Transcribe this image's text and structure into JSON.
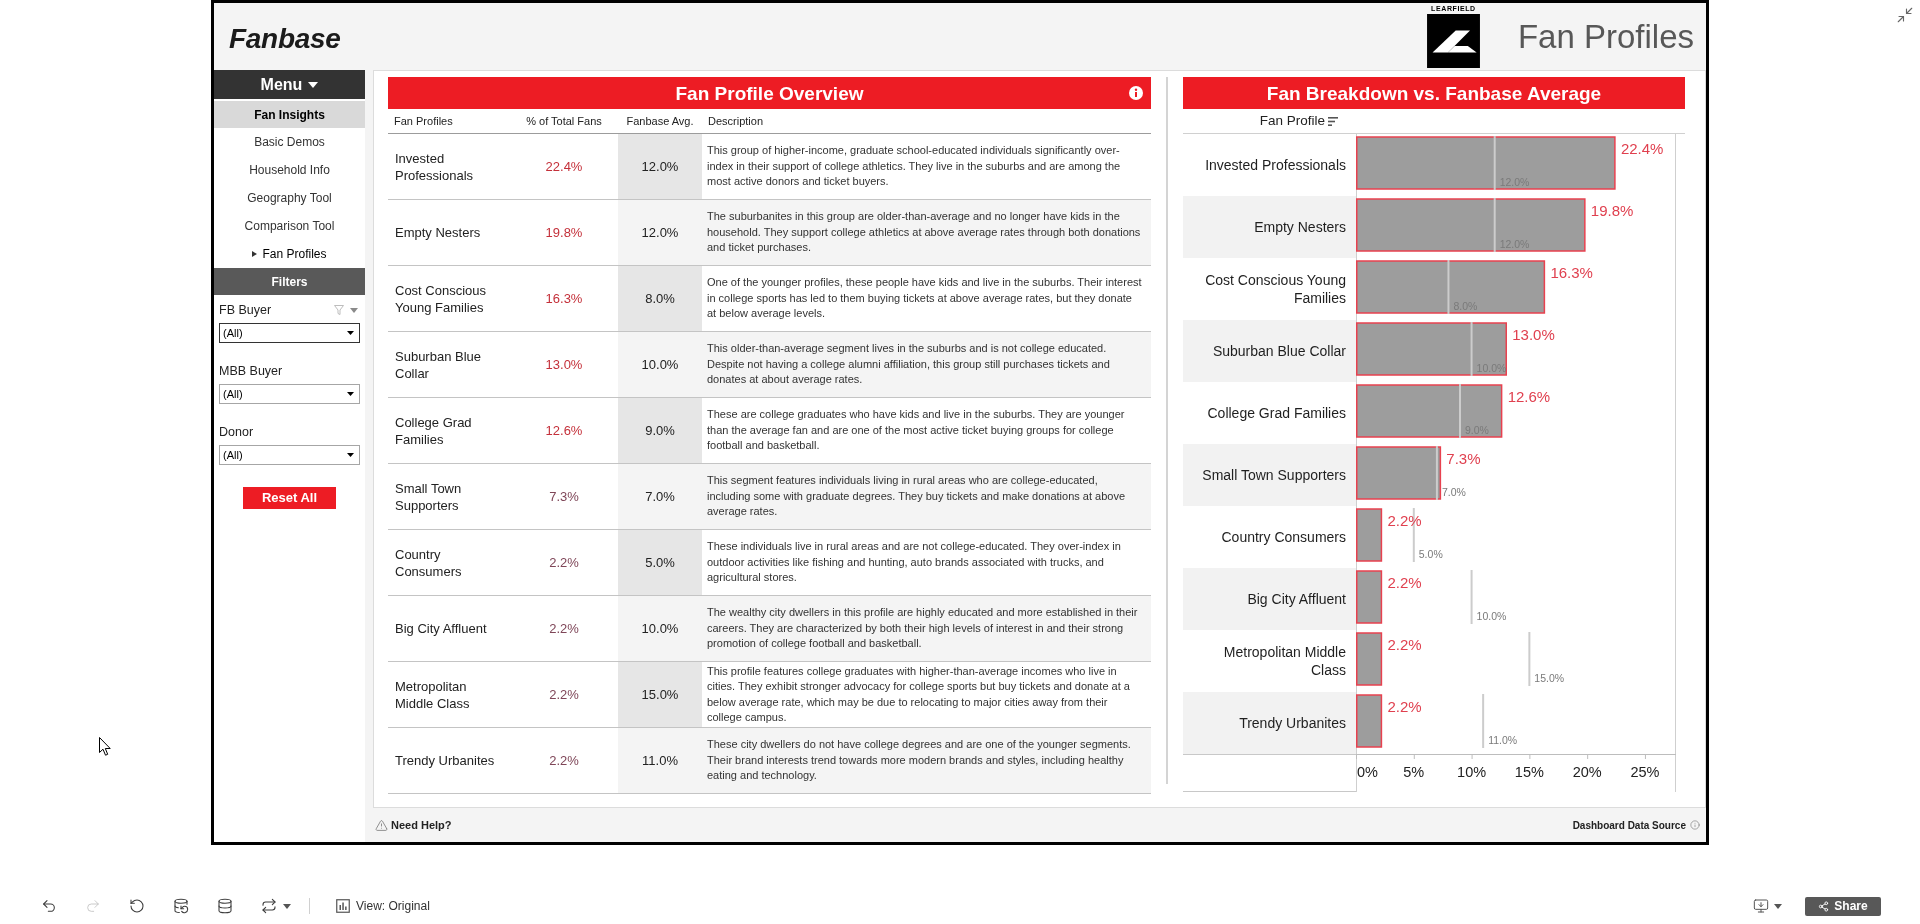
{
  "header": {
    "logo": "Fanbase",
    "partner_logo": "LEARFIELD",
    "title": "Fan Profiles"
  },
  "menu": {
    "title": "Menu",
    "section": "Fan Insights",
    "items": [
      {
        "label": "Basic Demos",
        "selected": false
      },
      {
        "label": "Household Info",
        "selected": false
      },
      {
        "label": "Geography Tool",
        "selected": false
      },
      {
        "label": "Comparison Tool",
        "selected": false
      },
      {
        "label": "Fan Profiles",
        "selected": true
      }
    ]
  },
  "filters": {
    "title": "Filters",
    "items": [
      {
        "label": "FB Buyer",
        "value": "(All)",
        "hovered": true
      },
      {
        "label": "MBB Buyer",
        "value": "(All)",
        "hovered": false
      },
      {
        "label": "Donor",
        "value": "(All)",
        "hovered": false
      }
    ],
    "reset_button": "Reset All"
  },
  "overview": {
    "title": "Fan Profile Overview",
    "columns": [
      "Fan Profiles",
      "% of Total Fans",
      "Fanbase Avg.",
      "Description"
    ],
    "rows": [
      {
        "profile": "Invested Professionals",
        "share": "22.4%",
        "color": "#c4303a",
        "average": "12.0%",
        "description": "This group of higher-income, graduate school-educated individuals significantly over-index in their support of college athletics. They live in the suburbs and are among the most active donors and ticket buyers."
      },
      {
        "profile": "Empty Nesters",
        "share": "19.8%",
        "color": "#c4303a",
        "average": "12.0%",
        "description": "The suburbanites in this group are older-than-average and no longer have kids in the household. They support college athletics at above average rates through both donations and ticket purchases."
      },
      {
        "profile": "Cost Conscious Young Families",
        "share": "16.3%",
        "color": "#c4303a",
        "average": "8.0%",
        "description": "One of the younger profiles, these people have kids and live in the suburbs. Their interest in college sports has led to them buying tickets at above average rates, but they donate at below average levels."
      },
      {
        "profile": "Suburban Blue Collar",
        "share": "13.0%",
        "color": "#c4303a",
        "average": "10.0%",
        "description": "This older-than-average segment lives in the suburbs and is not college educated. Despite not having a college alumni affiliation, this group still purchases tickets and donates at about average rates."
      },
      {
        "profile": "College Grad Families",
        "share": "12.6%",
        "color": "#c4303a",
        "average": "9.0%",
        "description": "These are college graduates who have kids and live in the suburbs. They are younger than the average fan and are one of the most active ticket buying groups for college football and basketball."
      },
      {
        "profile": "Small Town Supporters",
        "share": "7.3%",
        "color": "#7f4658",
        "average": "7.0%",
        "description": "This segment features individuals living in rural areas who are college-educated, including some with graduate degrees. They buy tickets and make donations at above average rates."
      },
      {
        "profile": "Country Consumers",
        "share": "2.2%",
        "color": "#7f4658",
        "average": "5.0%",
        "description": "These individuals live in rural areas and are not college-educated. They over-index in outdoor activities like fishing and hunting, auto brands associated with trucks, and agricultural stores."
      },
      {
        "profile": "Big City Affluent",
        "share": "2.2%",
        "color": "#7f4658",
        "average": "10.0%",
        "description": "The wealthy city dwellers in this profile are highly educated and more established in their careers. They are characterized by both their high levels of interest in and their strong promotion of college football and basketball."
      },
      {
        "profile": "Metropolitan Middle Class",
        "share": "2.2%",
        "color": "#7f4658",
        "average": "15.0%",
        "description": "This profile features college graduates with higher-than-average incomes who live in cities. They exhibit stronger advocacy for college sports but buy tickets and donate at a below average rate, which may be due to relocating to major cities away from their college campus."
      },
      {
        "profile": "Trendy Urbanites",
        "share": "2.2%",
        "color": "#7f4658",
        "average": "11.0%",
        "description": "These city dwellers do not have college degrees and are one of the younger segments. Their brand interests trend towards more modern brands and styles, including healthy eating and technology."
      }
    ]
  },
  "breakdown": {
    "chart_data": {
      "type": "bar",
      "orientation": "horizontal",
      "title": "Fan Breakdown vs. Fanbase Average",
      "ylabel": "Fan Profile",
      "categories": [
        "Invested Professionals",
        "Empty Nesters",
        "Cost Conscious Young Families",
        "Suburban Blue Collar",
        "College Grad Families",
        "Small Town Supporters",
        "Country Consumers",
        "Big City Affluent",
        "Metropolitan Middle Class",
        "Trendy Urbanites"
      ],
      "series": [
        {
          "color": "#9d9d9d",
          "values": [
            22.4,
            19.8,
            16.3,
            13.0,
            12.6,
            7.3,
            2.2,
            2.2,
            2.2,
            2.2
          ],
          "value_labels": [
            "22.4%",
            "19.8%",
            "16.3%",
            "13.0%",
            "12.6%",
            "7.3%",
            "2.2%",
            "2.2%",
            "2.2%",
            "2.2%"
          ]
        }
      ],
      "xlim": [
        0,
        27.6
      ],
      "xticks": [
        {
          "value": 0,
          "label": "0%"
        },
        {
          "value": 5,
          "label": "5%"
        },
        {
          "value": 10,
          "label": "10%"
        },
        {
          "value": 15,
          "label": "15%"
        },
        {
          "value": 20,
          "label": "20%"
        },
        {
          "value": 25,
          "label": "25%"
        }
      ],
      "annotations": [
        "12.0%",
        "12.0%",
        "8.0%",
        "10.0%",
        "9.0%",
        "7.0%",
        "5.0%",
        "10.0%",
        "15.0%",
        "11.0%"
      ]
    }
  },
  "footer": {
    "help": "Need Help?",
    "source": "Dashboard Data Source"
  },
  "toolbar": {
    "buttons": [
      {
        "kind": "undo",
        "disabled": false
      },
      {
        "kind": "redo",
        "disabled": true
      },
      {
        "kind": "revert",
        "disabled": false
      },
      {
        "kind": "refresh",
        "disabled": false
      },
      {
        "kind": "pause",
        "disabled": false
      },
      {
        "kind": "swap",
        "disabled": false
      }
    ],
    "view": "View: Original",
    "share": "Share"
  }
}
